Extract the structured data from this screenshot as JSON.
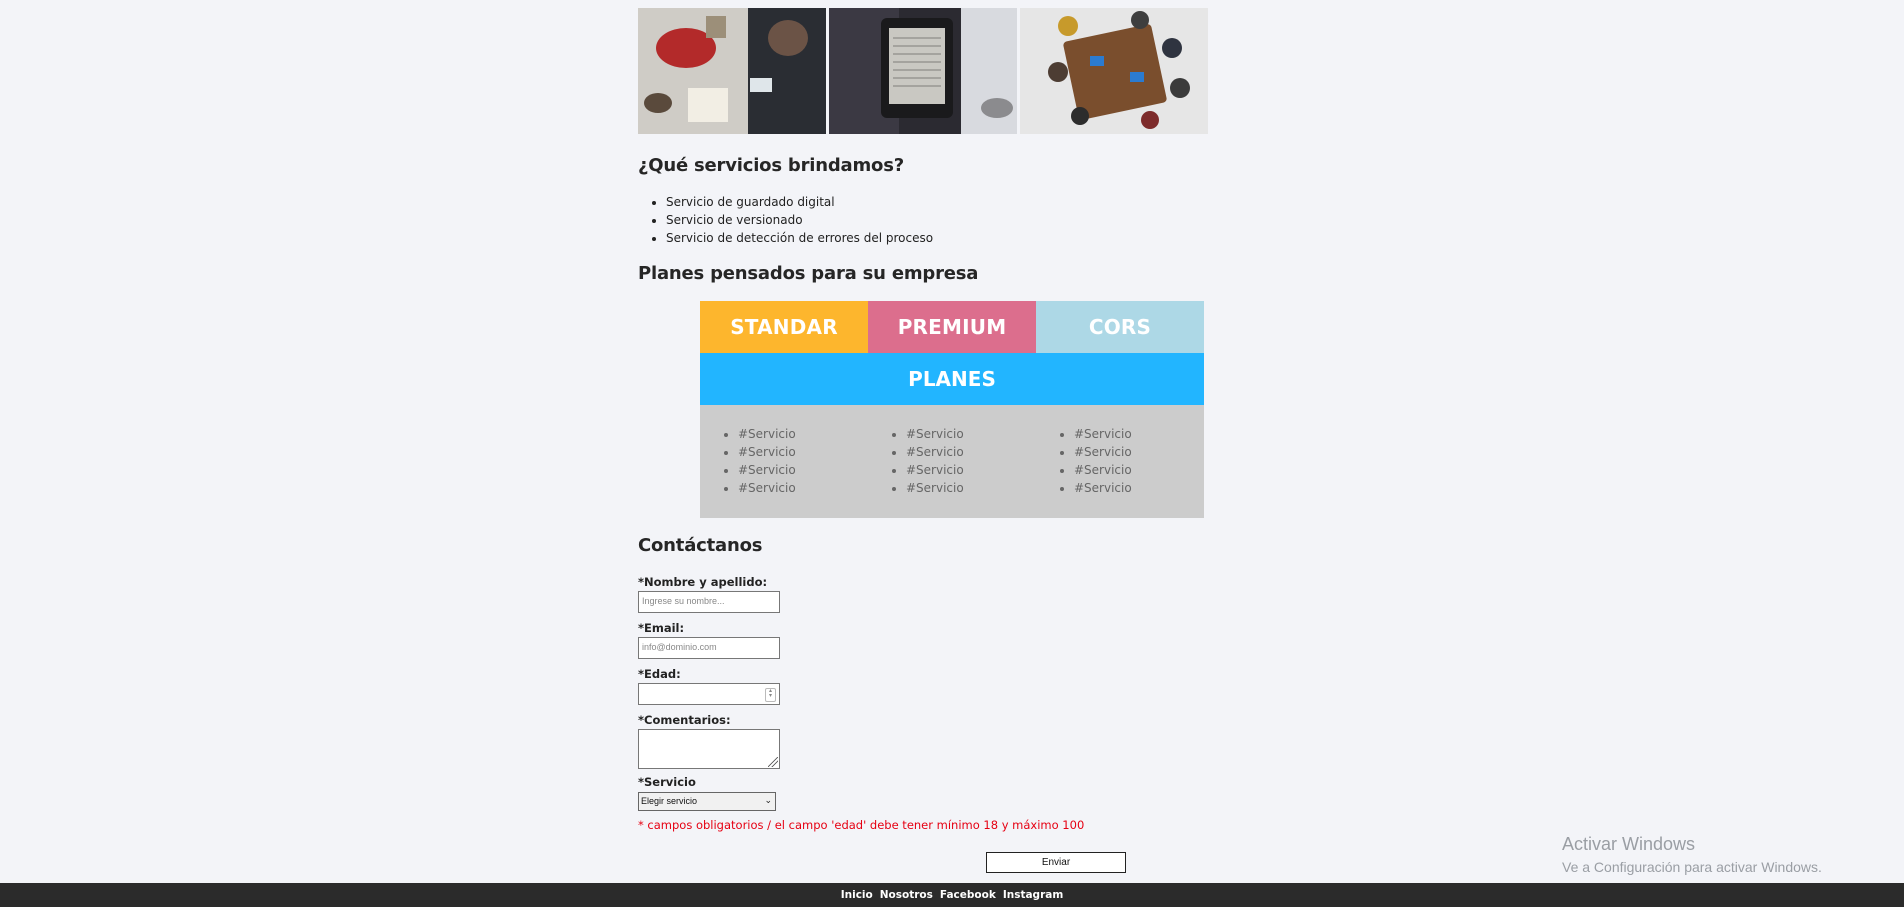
{
  "services": {
    "heading": "¿Qué servicios brindamos?",
    "items": [
      "Servicio de guardado digital",
      "Servicio de versionado",
      "Servicio de detección de errores del proceso"
    ]
  },
  "plans": {
    "heading": "Planes pensados para su empresa",
    "columns": [
      {
        "name": "STANDAR",
        "color": "#fdb62d"
      },
      {
        "name": "PREMIUM",
        "color": "#dc6e8d"
      },
      {
        "name": "CORS",
        "color": "#add8e6"
      }
    ],
    "banner": "PLANES",
    "banner_color": "#22b5ff",
    "item_label": "#Servicio"
  },
  "contact": {
    "heading": "Contáctanos",
    "name_label": "*Nombre y apellido:",
    "name_placeholder": "Ingrese su nombre...",
    "email_label": "*Email:",
    "email_placeholder": "info@dominio.com",
    "age_label": "*Edad:",
    "comments_label": "*Comentarios:",
    "service_label": "*Servicio",
    "service_selected": "Elegir servicio",
    "error_text": "* campos obligatorios / el campo 'edad' debe tener mínimo 18 y máximo 100",
    "submit_label": "Enviar"
  },
  "watermark": {
    "title": "Activar Windows",
    "subtitle": "Ve a Configuración para activar Windows."
  },
  "footer": {
    "links": [
      "Inicio",
      "Nosotros",
      "Facebook",
      "Instagram"
    ]
  }
}
